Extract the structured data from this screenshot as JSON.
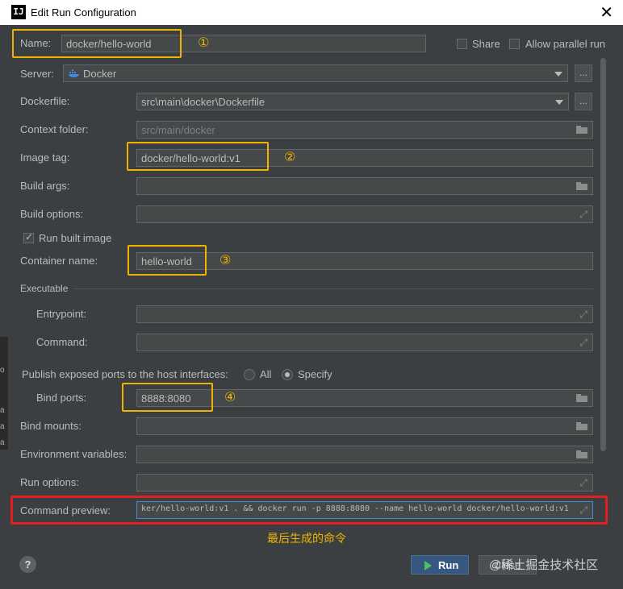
{
  "window": {
    "title": "Edit Run Configuration",
    "app_icon": "IJ"
  },
  "name_row": {
    "label": "Name:",
    "value": "docker/hello-world",
    "share_label": "Share",
    "parallel_label": "Allow parallel run"
  },
  "server": {
    "label": "Server:",
    "value": "Docker",
    "dots": "..."
  },
  "dockerfile": {
    "label": "Dockerfile:",
    "value": "src\\main\\docker\\Dockerfile",
    "dots": "..."
  },
  "context_folder": {
    "label": "Context folder:",
    "value": "src/main/docker"
  },
  "image_tag": {
    "label": "Image tag:",
    "value": "docker/hello-world:v1"
  },
  "build_args": {
    "label": "Build args:",
    "value": ""
  },
  "build_options": {
    "label": "Build options:",
    "value": ""
  },
  "run_built_image": {
    "label": "Run built image",
    "checked": true
  },
  "container_name": {
    "label": "Container name:",
    "value": "hello-world"
  },
  "executable": {
    "section": "Executable",
    "entrypoint_label": "Entrypoint:",
    "command_label": "Command:"
  },
  "publish": {
    "label": "Publish exposed ports to the host interfaces:",
    "all_label": "All",
    "specify_label": "Specify",
    "selected": "Specify"
  },
  "bind_ports": {
    "label": "Bind ports:",
    "value": "8888:8080"
  },
  "bind_mounts": {
    "label": "Bind mounts:"
  },
  "env_vars": {
    "label": "Environment variables:"
  },
  "run_options": {
    "label": "Run options:"
  },
  "command_preview": {
    "label": "Command preview:",
    "value": "ker/hello-world:v1 . && docker run -p 8888:8080 --name hello-world docker/hello-world:v1"
  },
  "annotations": {
    "n1": "①",
    "n2": "②",
    "n3": "③",
    "n4": "④",
    "note": "最后生成的命令"
  },
  "buttons": {
    "help": "?",
    "run": "Run",
    "close": "Close"
  },
  "watermark": "@稀土掘金技术社区",
  "left_edge": [
    "o",
    "a",
    "a",
    "a"
  ],
  "colors": {
    "accent": "#f0b400",
    "preview_highlight": "#e02020",
    "run_button": "#365880"
  },
  "icons": [
    "close-icon",
    "docker-icon",
    "folder-icon",
    "expand-icon",
    "play-icon",
    "help-icon",
    "dropdown-arrow-icon"
  ]
}
